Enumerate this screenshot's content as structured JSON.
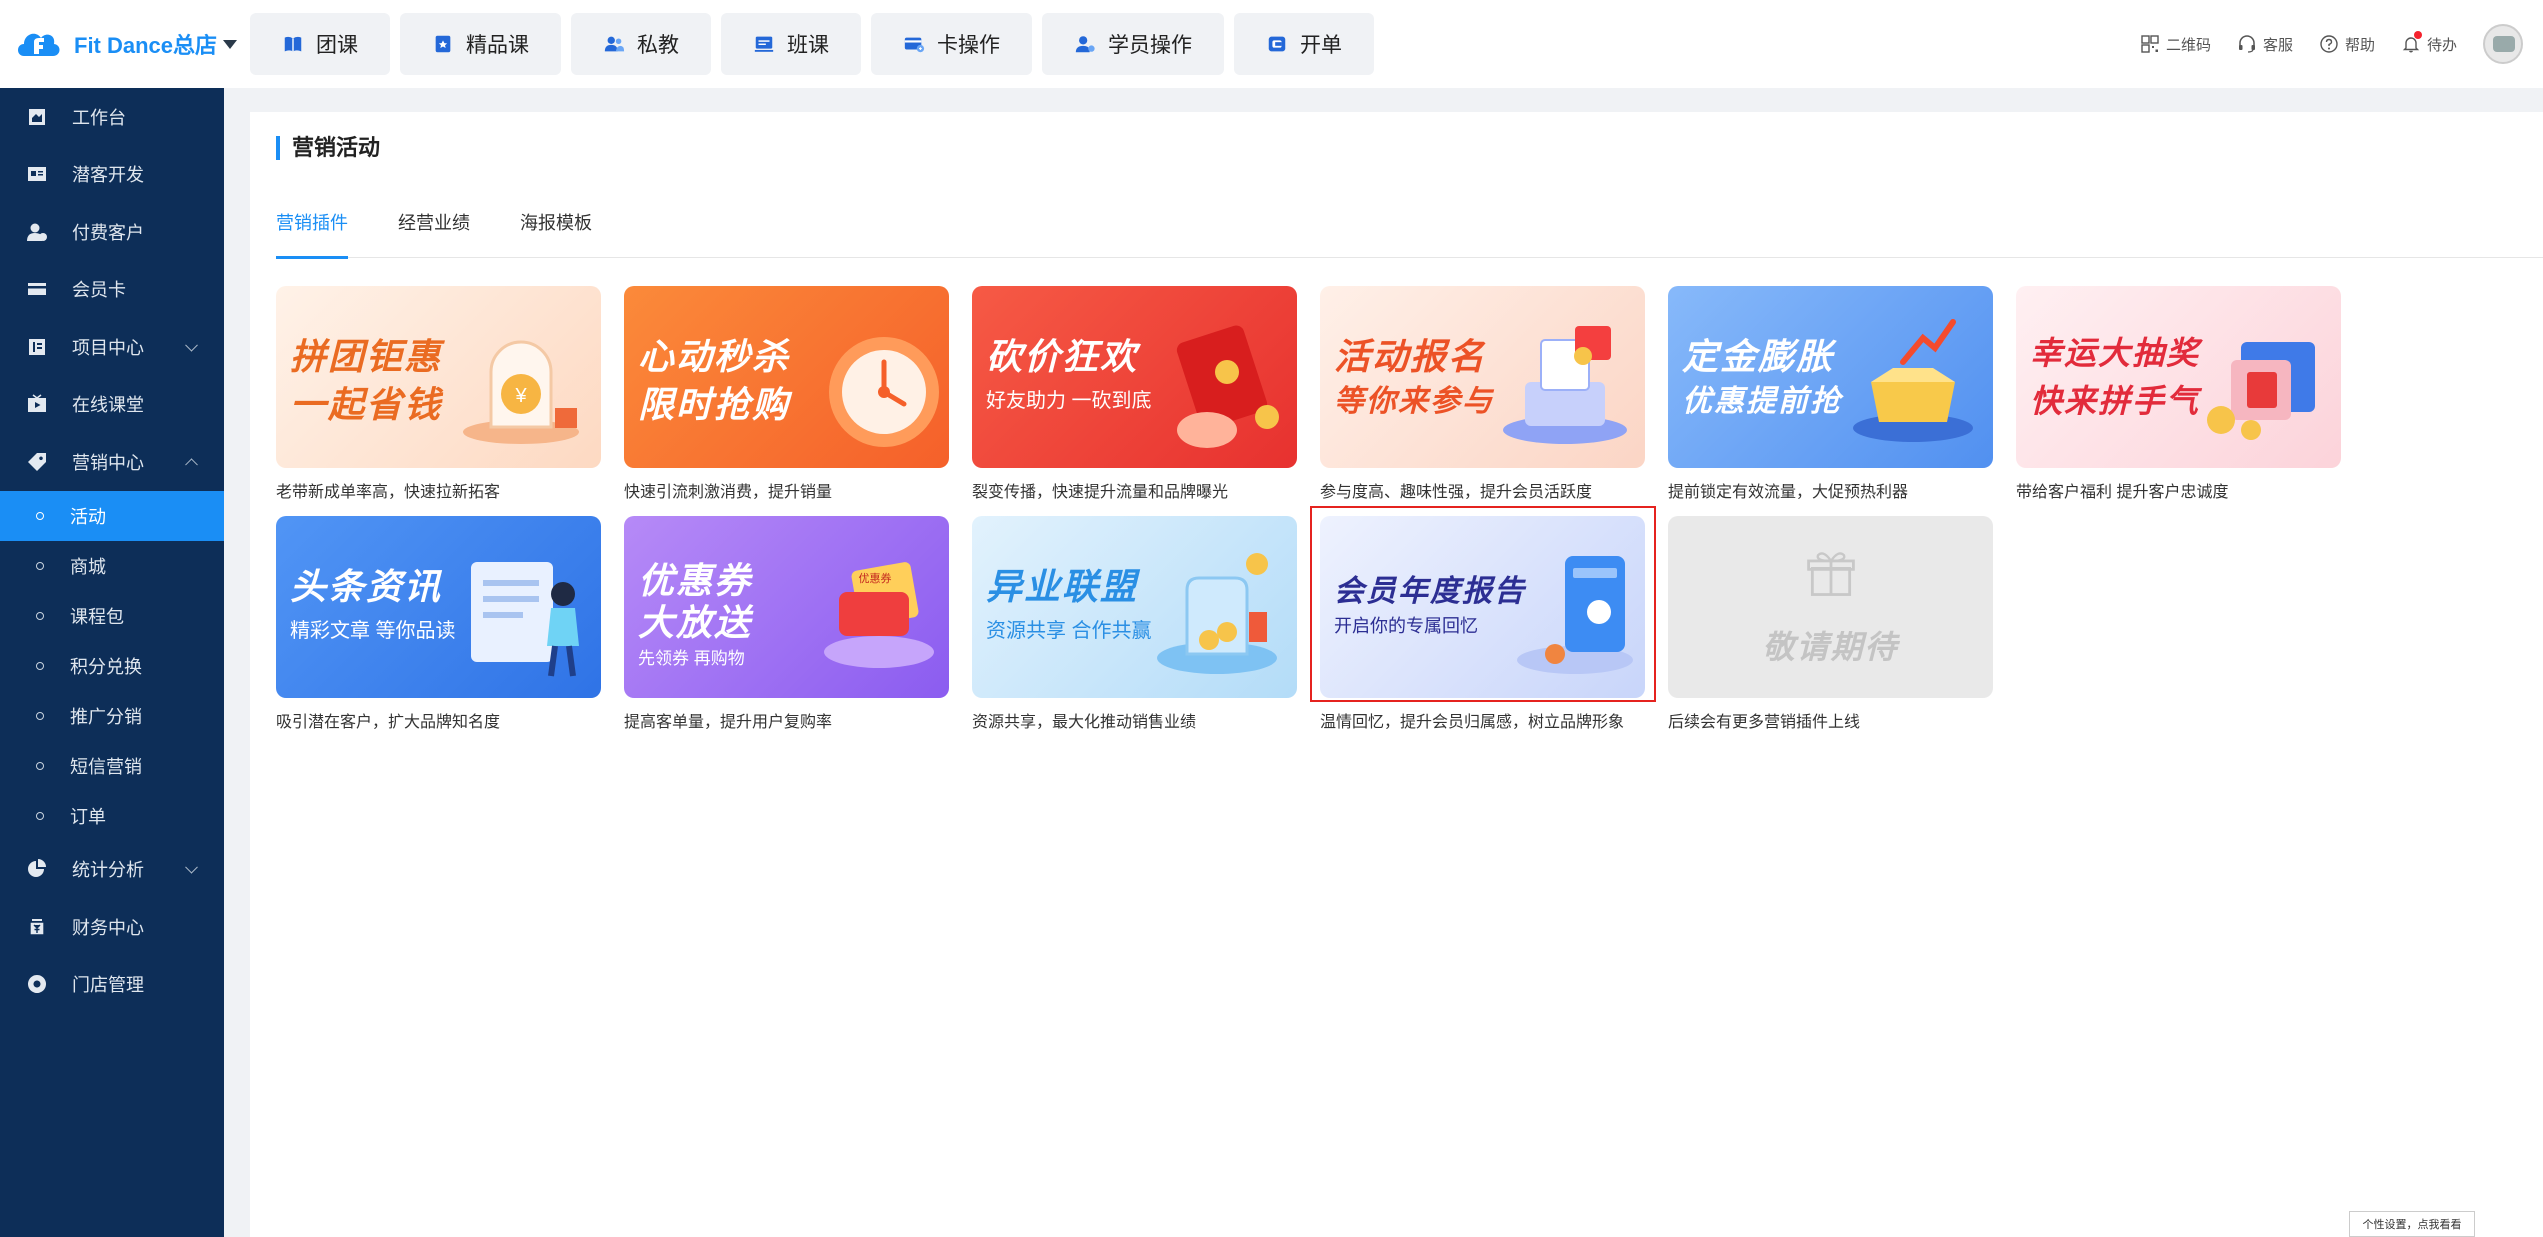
{
  "brand": {
    "name": "Fit Dance总店"
  },
  "topnav": [
    {
      "label": "团课",
      "icon": "book-icon"
    },
    {
      "label": "精品课",
      "icon": "premium-course-icon"
    },
    {
      "label": "私教",
      "icon": "private-coach-icon"
    },
    {
      "label": "班课",
      "icon": "class-icon"
    },
    {
      "label": "卡操作",
      "icon": "card-operation-icon"
    },
    {
      "label": "学员操作",
      "icon": "student-operation-icon"
    },
    {
      "label": "开单",
      "icon": "open-order-icon"
    }
  ],
  "toolbar": {
    "qrcode": "二维码",
    "service": "客服",
    "help": "帮助",
    "todo": "待办"
  },
  "sidebar": {
    "items": [
      {
        "label": "工作台"
      },
      {
        "label": "潜客开发"
      },
      {
        "label": "付费客户"
      },
      {
        "label": "会员卡"
      },
      {
        "label": "项目中心"
      },
      {
        "label": "在线课堂"
      },
      {
        "label": "营销中心"
      }
    ],
    "sub": [
      {
        "label": "活动"
      },
      {
        "label": "商城"
      },
      {
        "label": "课程包"
      },
      {
        "label": "积分兑换"
      },
      {
        "label": "推广分销"
      },
      {
        "label": "短信营销"
      },
      {
        "label": "订单"
      }
    ],
    "bottom": [
      {
        "label": "统计分析"
      },
      {
        "label": "财务中心"
      },
      {
        "label": "门店管理"
      }
    ]
  },
  "page": {
    "title": "营销活动",
    "tabs": [
      "营销插件",
      "经营业绩",
      "海报模板"
    ]
  },
  "cards": [
    {
      "line1": "拼团钜惠",
      "line2": "一起省钱",
      "sub": "",
      "desc": "老带新成单率高，快速拉新拓客",
      "bg": "#fde6d8",
      "color": "#e8702a"
    },
    {
      "line1": "心动秒杀",
      "line2": "限时抢购",
      "sub": "",
      "desc": "快速引流刺激消费，提升销量",
      "bg": "#fa7a2c",
      "color": "#ffffff"
    },
    {
      "line1": "砍价狂欢",
      "line2": "",
      "sub": "好友助力 一砍到底",
      "desc": "裂变传播，快速提升流量和品牌曝光",
      "bg": "#f0413b",
      "color": "#ffffff"
    },
    {
      "line1": "活动报名",
      "line2": "等你来参与",
      "sub": "",
      "desc": "参与度高、趣味性强，提升会员活跃度",
      "bg": "#fde3d6",
      "color": "#e8542a"
    },
    {
      "line1": "定金膨胀",
      "line2": "优惠提前抢",
      "sub": "",
      "desc": "提前锁定有效流量，大促预热利器",
      "bg": "#6ea7f6",
      "color": "#ffffff"
    },
    {
      "line1": "幸运大抽奖",
      "line2": "快来拼手气",
      "sub": "",
      "desc": "带给客户福利 提升客户忠诚度",
      "bg": "#fde2e6",
      "color": "#e4313f"
    },
    {
      "line1": "头条资讯",
      "line2": "",
      "sub": "精彩文章 等你品读",
      "desc": "吸引潜在客户，扩大品牌知名度",
      "bg": "#3f86f2",
      "color": "#ffffff"
    },
    {
      "line1": "优惠券",
      "line2": "大放送",
      "sub": "先领券 再购物",
      "desc": "提高客单量，提升用户复购率",
      "bg": "#a77af5",
      "color": "#ffffff"
    },
    {
      "line1": "异业联盟",
      "line2": "",
      "sub": "资源共享 合作共赢",
      "desc": "资源共享，最大化推动销售业绩",
      "bg": "#c9e6fb",
      "color": "#2c8ee5"
    },
    {
      "line1": "会员年度报告",
      "line2": "",
      "sub": "开启你的专属回忆",
      "desc": "温情回忆，提升会员归属感，树立品牌形象",
      "bg": "#d9e1fb",
      "color": "#2e2f9a"
    },
    {
      "line1": "敬请期待",
      "line2": "",
      "sub": "",
      "desc": "后续会有更多营销插件上线",
      "bg": "#e8e8e8",
      "color": "#c4c4c4"
    }
  ],
  "footer_tip": "个性设置，点我看看"
}
